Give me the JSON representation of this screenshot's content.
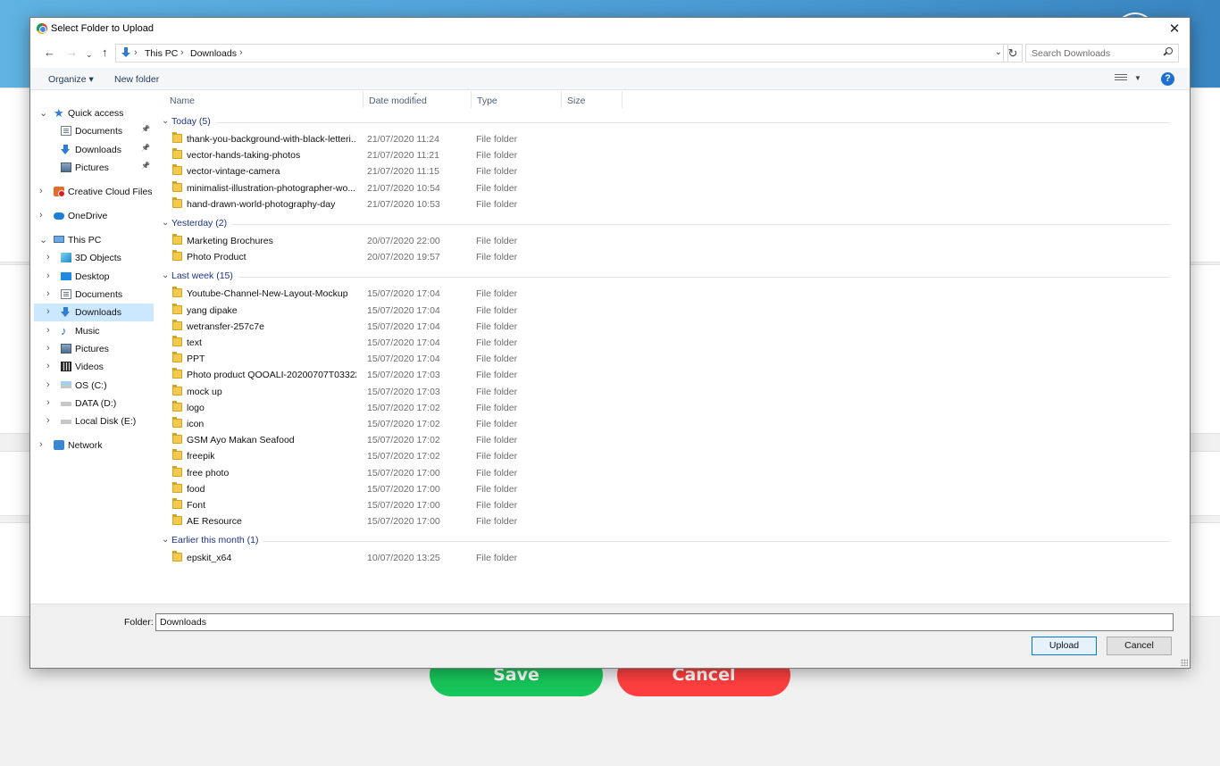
{
  "background": {
    "save_label": "Save",
    "cancel_label": "Cancel"
  },
  "dialog": {
    "title": "Select Folder to Upload",
    "address": {
      "crumbs": [
        "This PC",
        "Downloads"
      ]
    },
    "search_placeholder": "Search Downloads",
    "toolbar": {
      "organize": "Organize ▾",
      "new_folder": "New folder"
    },
    "nav": [
      {
        "label": "Quick access",
        "icon": "quick-access-star-icon",
        "expander": "⌄",
        "pinned": false
      },
      {
        "label": "Documents",
        "icon": "documents-icon",
        "expander": "",
        "pinned": true
      },
      {
        "label": "Downloads",
        "icon": "downloads-icon",
        "expander": "",
        "pinned": true
      },
      {
        "label": "Pictures",
        "icon": "pictures-icon",
        "expander": "",
        "pinned": true
      },
      {
        "label": "Creative Cloud Files",
        "icon": "creative-cloud-icon",
        "expander": "›",
        "pinned": false
      },
      {
        "label": "OneDrive",
        "icon": "onedrive-cloud-icon",
        "expander": "›",
        "pinned": false
      },
      {
        "label": "This PC",
        "icon": "this-pc-icon",
        "expander": "⌄",
        "pinned": false
      },
      {
        "label": "3D Objects",
        "icon": "3d-objects-icon",
        "expander": "›",
        "pinned": false
      },
      {
        "label": "Desktop",
        "icon": "desktop-icon",
        "expander": "›",
        "pinned": false
      },
      {
        "label": "Documents",
        "icon": "documents-icon",
        "expander": "›",
        "pinned": false
      },
      {
        "label": "Downloads",
        "icon": "downloads-icon",
        "expander": "›",
        "pinned": false,
        "selected": true
      },
      {
        "label": "Music",
        "icon": "music-icon",
        "expander": "›",
        "pinned": false
      },
      {
        "label": "Pictures",
        "icon": "pictures-icon",
        "expander": "›",
        "pinned": false
      },
      {
        "label": "Videos",
        "icon": "videos-icon",
        "expander": "›",
        "pinned": false
      },
      {
        "label": "OS (C:)",
        "icon": "os-drive-icon",
        "expander": "›",
        "pinned": false
      },
      {
        "label": "DATA (D:)",
        "icon": "drive-icon",
        "expander": "›",
        "pinned": false
      },
      {
        "label": "Local Disk (E:)",
        "icon": "drive-icon",
        "expander": "›",
        "pinned": false
      },
      {
        "label": "Network",
        "icon": "network-icon",
        "expander": "›",
        "pinned": false
      }
    ],
    "columns": [
      "Name",
      "Date modified",
      "Type",
      "Size"
    ],
    "groups": [
      {
        "label": "Today (5)",
        "items": [
          {
            "name": "thank-you-background-with-black-letteri...",
            "date": "21/07/2020 11:24",
            "type": "File folder"
          },
          {
            "name": "vector-hands-taking-photos",
            "date": "21/07/2020 11:21",
            "type": "File folder"
          },
          {
            "name": "vector-vintage-camera",
            "date": "21/07/2020 11:15",
            "type": "File folder"
          },
          {
            "name": "minimalist-illustration-photographer-wo...",
            "date": "21/07/2020 10:54",
            "type": "File folder"
          },
          {
            "name": "hand-drawn-world-photography-day",
            "date": "21/07/2020 10:53",
            "type": "File folder"
          }
        ]
      },
      {
        "label": "Yesterday (2)",
        "items": [
          {
            "name": "Marketing Brochures",
            "date": "20/07/2020 22:00",
            "type": "File folder"
          },
          {
            "name": "Photo Product",
            "date": "20/07/2020 19:57",
            "type": "File folder"
          }
        ]
      },
      {
        "label": "Last week (15)",
        "items": [
          {
            "name": "Youtube-Channel-New-Layout-Mockup",
            "date": "15/07/2020 17:04",
            "type": "File folder"
          },
          {
            "name": "yang dipake",
            "date": "15/07/2020 17:04",
            "type": "File folder"
          },
          {
            "name": "wetransfer-257c7e",
            "date": "15/07/2020 17:04",
            "type": "File folder"
          },
          {
            "name": "text",
            "date": "15/07/2020 17:04",
            "type": "File folder"
          },
          {
            "name": "PPT",
            "date": "15/07/2020 17:04",
            "type": "File folder"
          },
          {
            "name": "Photo product QOOALI-20200707T03322...",
            "date": "15/07/2020 17:03",
            "type": "File folder"
          },
          {
            "name": "mock up",
            "date": "15/07/2020 17:03",
            "type": "File folder"
          },
          {
            "name": "logo",
            "date": "15/07/2020 17:02",
            "type": "File folder"
          },
          {
            "name": "icon",
            "date": "15/07/2020 17:02",
            "type": "File folder"
          },
          {
            "name": "GSM Ayo Makan Seafood",
            "date": "15/07/2020 17:02",
            "type": "File folder"
          },
          {
            "name": "freepik",
            "date": "15/07/2020 17:02",
            "type": "File folder"
          },
          {
            "name": "free photo",
            "date": "15/07/2020 17:00",
            "type": "File folder"
          },
          {
            "name": "food",
            "date": "15/07/2020 17:00",
            "type": "File folder"
          },
          {
            "name": "Font",
            "date": "15/07/2020 17:00",
            "type": "File folder"
          },
          {
            "name": "AE Resource",
            "date": "15/07/2020 17:00",
            "type": "File folder"
          }
        ]
      },
      {
        "label": "Earlier this month (1)",
        "items": [
          {
            "name": "epskit_x64",
            "date": "10/07/2020 13:25",
            "type": "File folder"
          }
        ]
      }
    ],
    "folder_label": "Folder:",
    "folder_value": "Downloads",
    "upload_label": "Upload",
    "cancel_label": "Cancel"
  }
}
